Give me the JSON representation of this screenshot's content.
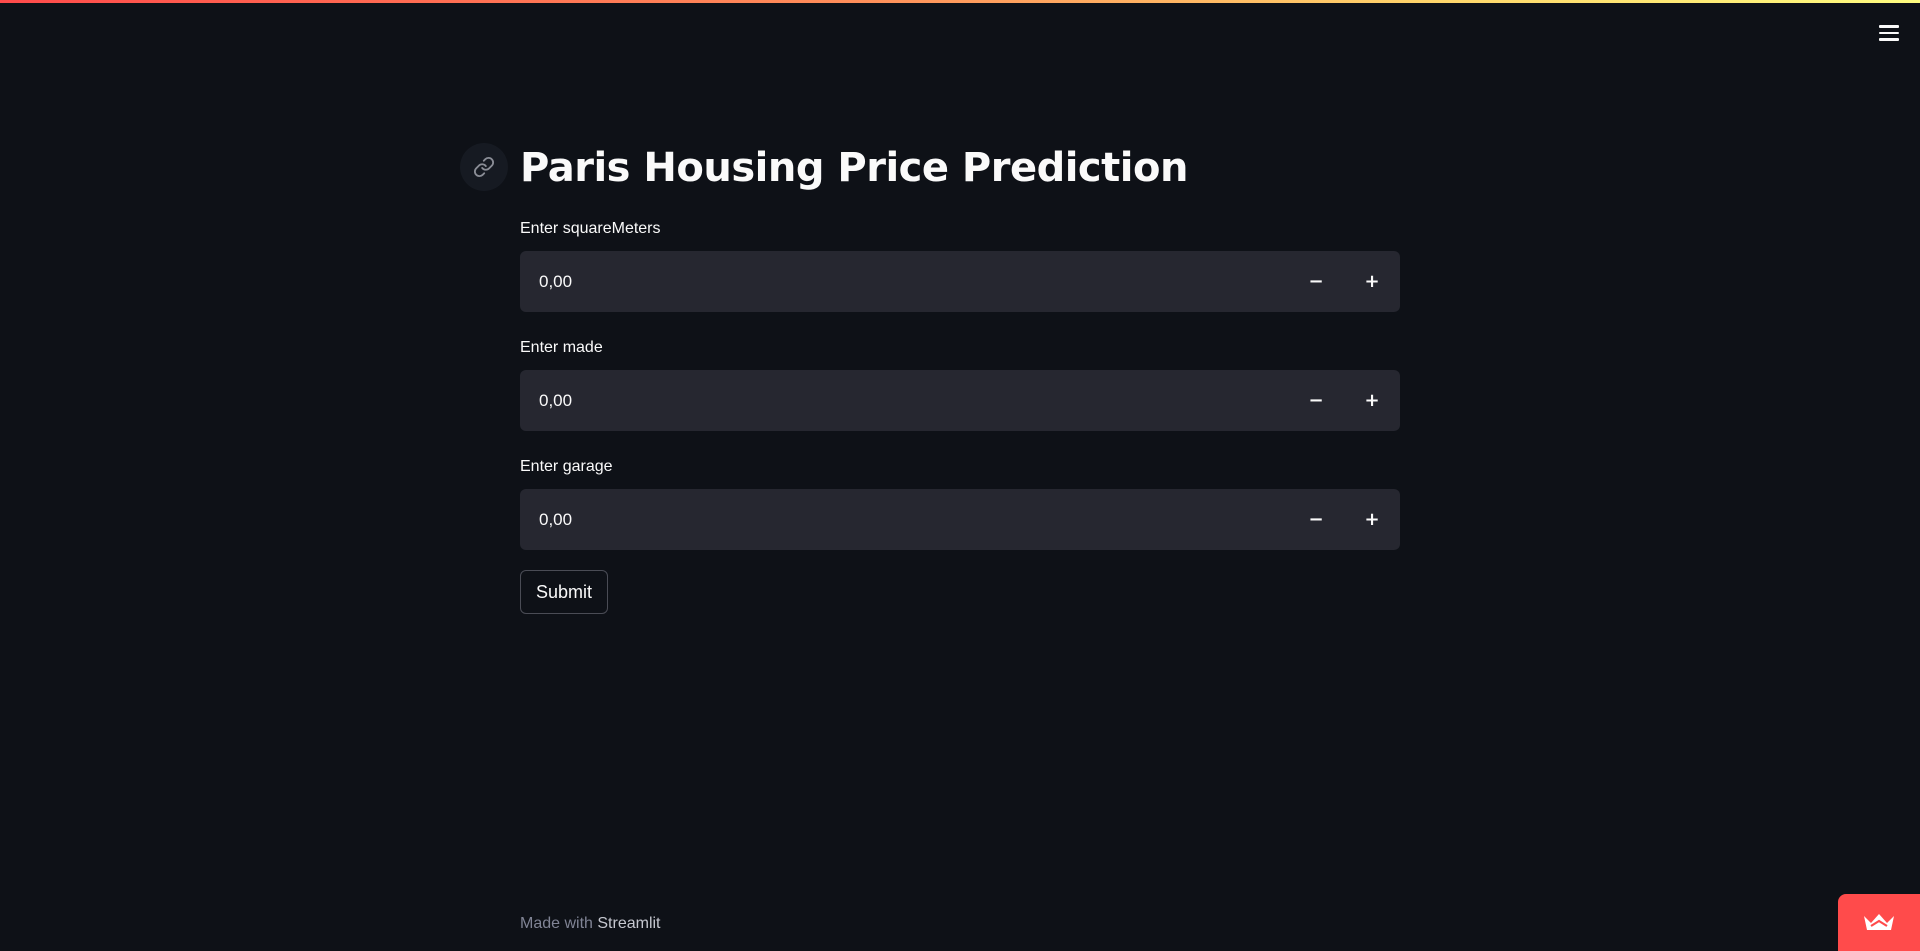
{
  "app": {
    "title": "Paris Housing Price Prediction"
  },
  "form": {
    "fields": [
      {
        "label": "Enter squareMeters",
        "value": "0,00",
        "decrement": "−",
        "increment": "+"
      },
      {
        "label": "Enter made",
        "value": "0,00",
        "decrement": "−",
        "increment": "+"
      },
      {
        "label": "Enter garage",
        "value": "0,00",
        "decrement": "−",
        "increment": "+"
      }
    ],
    "submit_label": "Submit"
  },
  "footer": {
    "prefix": "Made with",
    "brand": "Streamlit"
  },
  "icons": {
    "menu": "hamburger-menu-icon",
    "anchor": "link-icon",
    "badge": "streamlit-crown-icon"
  },
  "colors": {
    "background": "#0e1117",
    "input_background": "#262730",
    "accent": "#ff4b4b",
    "text": "#fafafa"
  }
}
